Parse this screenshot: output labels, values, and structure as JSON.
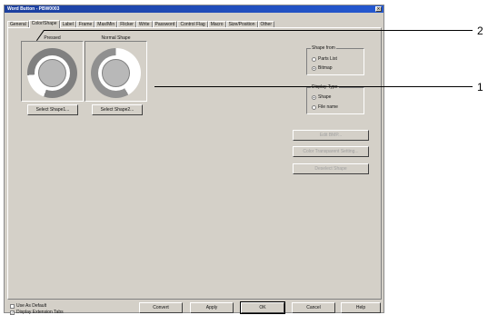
{
  "window": {
    "title": "Word Button - PBW0003",
    "close_symbol": "×"
  },
  "tabs": [
    {
      "label": "General"
    },
    {
      "label": "Color/Shape"
    },
    {
      "label": "Label"
    },
    {
      "label": "Frame"
    },
    {
      "label": "Max/Min"
    },
    {
      "label": "Flicker"
    },
    {
      "label": "Write"
    },
    {
      "label": "Password"
    },
    {
      "label": "Control Flag"
    },
    {
      "label": "Macro"
    },
    {
      "label": "Size/Position"
    },
    {
      "label": "Other"
    }
  ],
  "active_tab": "Color/Shape",
  "shapes": {
    "pressed": {
      "label": "Pressed",
      "button": "Select Shape1..."
    },
    "normal": {
      "label": "Normal Shape",
      "button": "Select Shape2..."
    }
  },
  "shape_from": {
    "title": "Shape from",
    "options": [
      {
        "label": "Parts List",
        "checked": false
      },
      {
        "label": "Bitmap",
        "checked": true
      }
    ]
  },
  "display_type": {
    "title": "Display Type",
    "options": [
      {
        "label": "Shape",
        "checked": true
      },
      {
        "label": "File name",
        "checked": false
      }
    ]
  },
  "side_buttons": [
    "Edit BMP...",
    "Color Transparent Setting...",
    "Deselect Shape"
  ],
  "footer": {
    "use_as_default": "Use As Default",
    "use_as_default_checked": false,
    "display_extension_tabs": "Display Extension Tabs",
    "display_extension_tabs_checked": true,
    "convert": "Convert",
    "apply": "Apply",
    "ok": "OK",
    "cancel": "Cancel",
    "help": "Help"
  },
  "callouts": {
    "one": "1",
    "two": "2"
  },
  "colors": {
    "title_bar": "#1c3f9e",
    "dialog_face": "#d4d0c8"
  }
}
